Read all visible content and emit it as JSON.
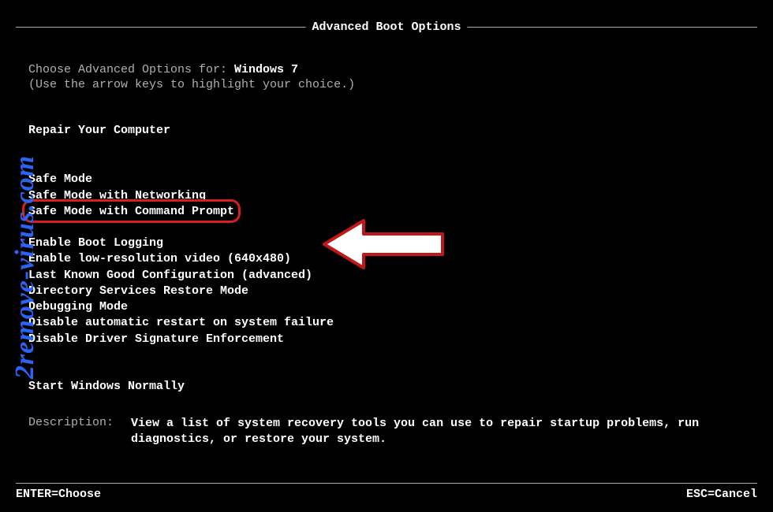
{
  "title": "Advanced Boot Options",
  "choose_prefix": "Choose Advanced Options for: ",
  "os_name": "Windows 7",
  "hint": "(Use the arrow keys to highlight your choice.)",
  "repair": "Repair Your Computer",
  "options_group1": [
    "Safe Mode",
    "Safe Mode with Networking",
    "Safe Mode with Command Prompt"
  ],
  "options_group2": [
    "Enable Boot Logging",
    "Enable low-resolution video (640x480)",
    "Last Known Good Configuration (advanced)",
    "Directory Services Restore Mode",
    "Debugging Mode",
    "Disable automatic restart on system failure",
    "Disable Driver Signature Enforcement"
  ],
  "options_group3": [
    "Start Windows Normally"
  ],
  "highlighted_index": 2,
  "description_label": "Description:",
  "description_text": "View a list of system recovery tools you can use to repair startup problems, run diagnostics, or restore your system.",
  "footer_left": "ENTER=Choose",
  "footer_right": "ESC=Cancel",
  "watermark": "2remove-virus.com",
  "colors": {
    "highlight_ring": "#d42020",
    "watermark": "#2b64f5"
  }
}
